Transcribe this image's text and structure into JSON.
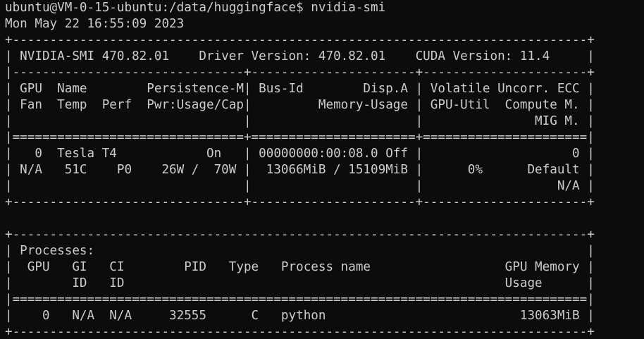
{
  "terminal": {
    "prompt_line": "ubuntu@VM-0-15-ubuntu:/data/huggingface$ nvidia-smi",
    "timestamp_line": "Mon May 22 16:55:09 2023",
    "gpu_table": [
      "+-----------------------------------------------------------------------------+",
      "| NVIDIA-SMI 470.82.01    Driver Version: 470.82.01    CUDA Version: 11.4     |",
      "|-------------------------------+----------------------+----------------------+",
      "| GPU  Name        Persistence-M| Bus-Id        Disp.A | Volatile Uncorr. ECC |",
      "| Fan  Temp  Perf  Pwr:Usage/Cap|         Memory-Usage | GPU-Util  Compute M. |",
      "|                               |                      |               MIG M. |",
      "|===============================+======================+======================|",
      "|   0  Tesla T4            On   | 00000000:00:08.0 Off |                    0 |",
      "| N/A   51C    P0    26W /  70W |  13066MiB / 15109MiB |      0%      Default |",
      "|                               |                      |                  N/A |",
      "+-------------------------------+----------------------+----------------------+"
    ],
    "blank_line": "",
    "process_table": [
      "+-----------------------------------------------------------------------------+",
      "| Processes:                                                                  |",
      "|  GPU   GI   CI        PID   Type   Process name                  GPU Memory |",
      "|        ID   ID                                                   Usage      |",
      "|=============================================================================|",
      "|    0   N/A  N/A     32555      C   python                          13063MiB |",
      "+-----------------------------------------------------------------------------+"
    ]
  }
}
